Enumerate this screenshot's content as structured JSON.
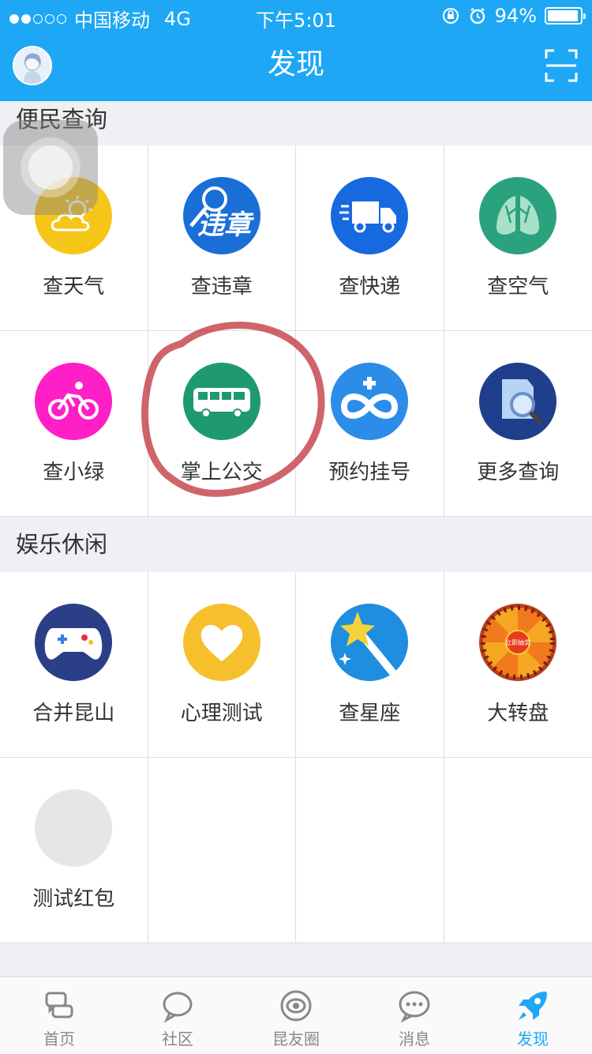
{
  "status_bar": {
    "carrier": "中国移动",
    "network": "4G",
    "time": "下午5:01",
    "battery": "94%",
    "battery_level": 0.94
  },
  "header": {
    "title": "发现"
  },
  "sections": [
    {
      "title": "便民查询",
      "items": [
        {
          "label": "查天气",
          "icon": "weather-icon",
          "color": "#f5c518"
        },
        {
          "label": "查违章",
          "icon": "traffic-violation-icon",
          "color": "#1a6fd6",
          "icon_text": "违章"
        },
        {
          "label": "查快递",
          "icon": "delivery-truck-icon",
          "color": "#1769e0"
        },
        {
          "label": "查空气",
          "icon": "lungs-icon",
          "color": "#2aa27e"
        },
        {
          "label": "查小绿",
          "icon": "bicycle-icon",
          "color": "#ff1fc6"
        },
        {
          "label": "掌上公交",
          "icon": "bus-icon",
          "color": "#1f9a6e"
        },
        {
          "label": "预约挂号",
          "icon": "hospital-cross-icon",
          "color": "#2b8de8"
        },
        {
          "label": "更多查询",
          "icon": "magnifier-icon",
          "color": "#1f3f8c"
        }
      ]
    },
    {
      "title": "娱乐休闲",
      "items": [
        {
          "label": "合并昆山",
          "icon": "gamepad-icon",
          "color": "#2a3f86"
        },
        {
          "label": "心理测试",
          "icon": "heart-icon",
          "color": "#f6c02d"
        },
        {
          "label": "查星座",
          "icon": "magic-wand-star-icon",
          "color": "#1f8de0"
        },
        {
          "label": "大转盘",
          "icon": "prize-wheel-icon",
          "color": "#b8401e",
          "icon_text": "立即抽奖"
        },
        {
          "label": "测试红包",
          "icon": "placeholder-icon",
          "color": "#e6e6e6"
        }
      ]
    }
  ],
  "tabbar": {
    "items": [
      {
        "label": "首页",
        "icon": "home-chat-icon"
      },
      {
        "label": "社区",
        "icon": "community-bubble-icon"
      },
      {
        "label": "昆友圈",
        "icon": "moments-camera-icon"
      },
      {
        "label": "消息",
        "icon": "message-icon"
      },
      {
        "label": "发现",
        "icon": "rocket-icon",
        "active": true
      }
    ]
  },
  "colors": {
    "brand": "#1ea7f5",
    "annotation": "#c0303a"
  }
}
